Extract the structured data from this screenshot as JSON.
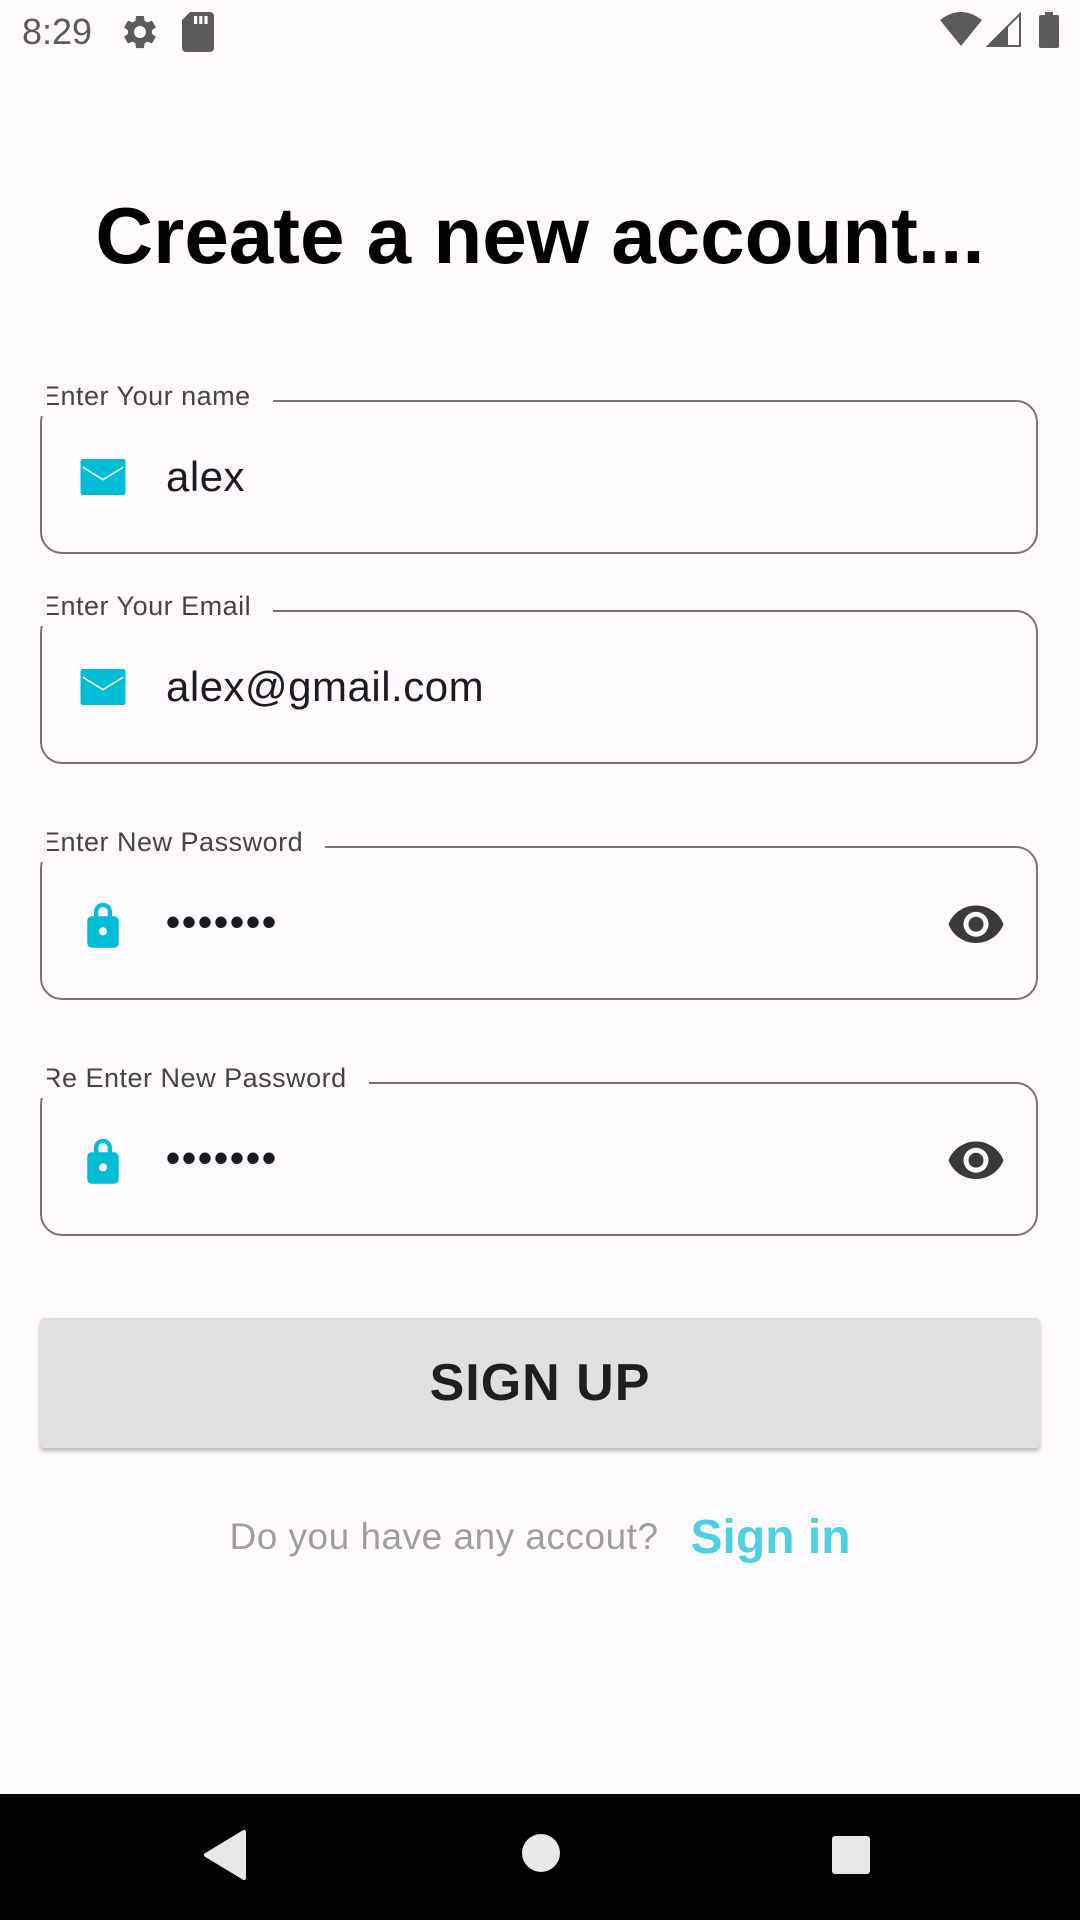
{
  "status_bar": {
    "time": "8:29",
    "icons": [
      "gear-icon",
      "sd-card-icon",
      "wifi-icon",
      "signal-icon",
      "battery-icon"
    ]
  },
  "title": "Create a new account...",
  "form": {
    "name": {
      "label": "Enter Your name",
      "value": "alex",
      "icon": "mail-icon"
    },
    "email": {
      "label": "Enter Your Email",
      "value": "alex@gmail.com",
      "icon": "mail-icon"
    },
    "password": {
      "label": "Enter New Password",
      "value": "•••••••",
      "icon": "lock-icon",
      "toggle_icon": "eye-icon"
    },
    "repassword": {
      "label": "Re Enter New Password",
      "value": "•••••••",
      "icon": "lock-icon",
      "toggle_icon": "eye-icon"
    }
  },
  "signup_button": {
    "label": "SIGN UP"
  },
  "footer": {
    "prompt": "Do you have any accout?",
    "signin_label": "Sign in"
  },
  "nav_bar": {
    "icons": [
      "back-icon",
      "home-icon",
      "recents-icon"
    ]
  },
  "colors": {
    "accent": "#00bcd4",
    "link": "#4dd0e1",
    "background": "#fffbfe",
    "outline": "#757575",
    "button": "#e0e0e0"
  }
}
